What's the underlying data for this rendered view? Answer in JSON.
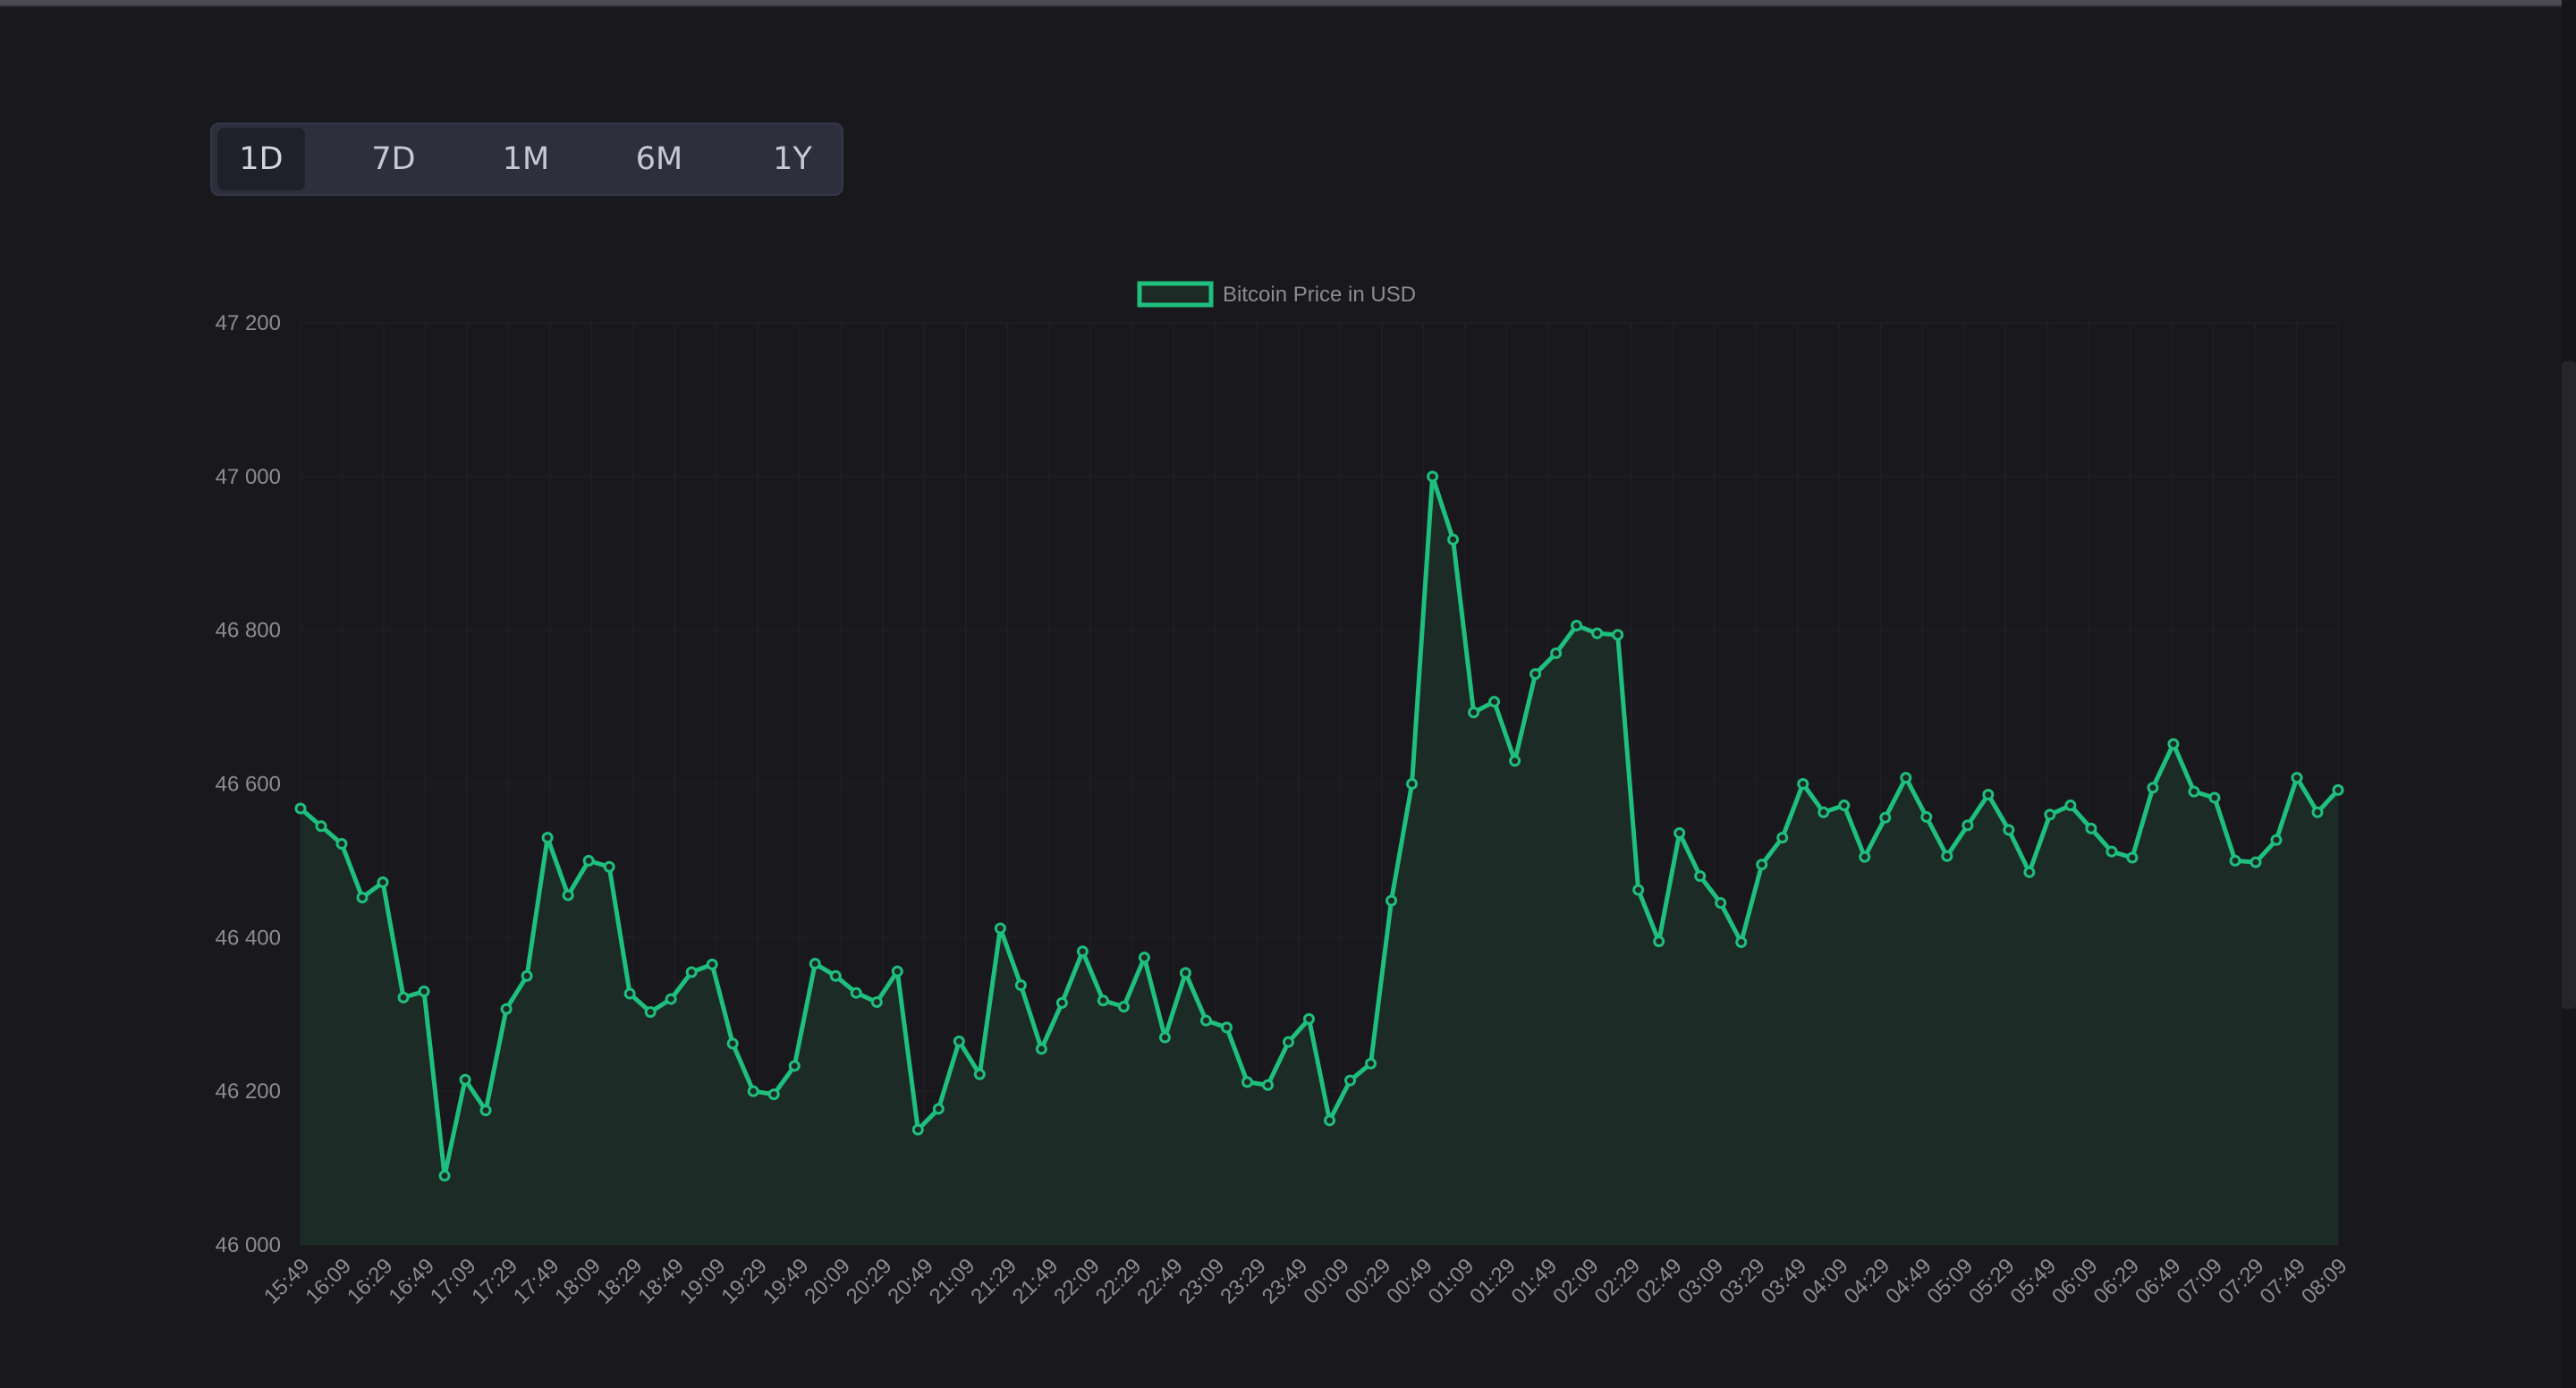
{
  "range_selector": {
    "options": [
      "1D",
      "7D",
      "1M",
      "6M",
      "1Y"
    ],
    "selected": "1D"
  },
  "colors": {
    "line": "#1fbf7e",
    "fill": "#1c2b26",
    "background": "#19191d",
    "grid": "#202024",
    "text": "#8b8b92"
  },
  "chart_data": {
    "type": "area",
    "title": "",
    "xlabel": "",
    "ylabel": "",
    "legend": "top-center",
    "grid": true,
    "ylim": [
      46000,
      47200
    ],
    "y_ticks": [
      "47 200",
      "47 000",
      "46 800",
      "46 600",
      "46 400",
      "46 200",
      "46 000"
    ],
    "y_tick_values": [
      47200,
      47000,
      46800,
      46600,
      46400,
      46200,
      46000
    ],
    "x_tick_labels": [
      "15:49",
      "16:09",
      "16:29",
      "16:49",
      "17:09",
      "17:29",
      "17:49",
      "18:09",
      "18:29",
      "18:49",
      "19:09",
      "19:29",
      "19:49",
      "20:09",
      "20:29",
      "20:49",
      "21:09",
      "21:29",
      "21:49",
      "22:09",
      "22:29",
      "22:49",
      "23:09",
      "23:29",
      "23:49",
      "00:09",
      "00:29",
      "00:49",
      "01:09",
      "01:29",
      "01:49",
      "02:09",
      "02:29",
      "02:49",
      "03:09",
      "03:29",
      "03:49",
      "04:09",
      "04:29",
      "04:49",
      "05:09",
      "05:29",
      "05:49",
      "06:09",
      "06:29",
      "06:49",
      "07:09",
      "07:29",
      "07:49",
      "08:09"
    ],
    "series": [
      {
        "name": "Bitcoin Price in USD",
        "values": [
          46568,
          46545,
          46522,
          46452,
          46472,
          46322,
          46330,
          46090,
          46215,
          46175,
          46307,
          46350,
          46530,
          46455,
          46500,
          46492,
          46327,
          46303,
          46320,
          46355,
          46365,
          46262,
          46200,
          46196,
          46233,
          46366,
          46350,
          46328,
          46316,
          46356,
          46150,
          46177,
          46265,
          46222,
          46412,
          46338,
          46255,
          46315,
          46382,
          46318,
          46310,
          46374,
          46270,
          46354,
          46292,
          46283,
          46212,
          46208,
          46264,
          46294,
          46162,
          46214,
          46236,
          46448,
          46600,
          47000,
          46918,
          46693,
          46707,
          46630,
          46743,
          46770,
          46806,
          46796,
          46794,
          46462,
          46395,
          46536,
          46480,
          46445,
          46394,
          46495,
          46530,
          46600,
          46563,
          46572,
          46505,
          46556,
          46608,
          46557,
          46506,
          46546,
          46586,
          46540,
          46485,
          46560,
          46572,
          46542,
          46512,
          46504,
          46595,
          46652,
          46590,
          46582,
          46500,
          46498,
          46527,
          46608,
          46563,
          46592
        ]
      }
    ]
  }
}
